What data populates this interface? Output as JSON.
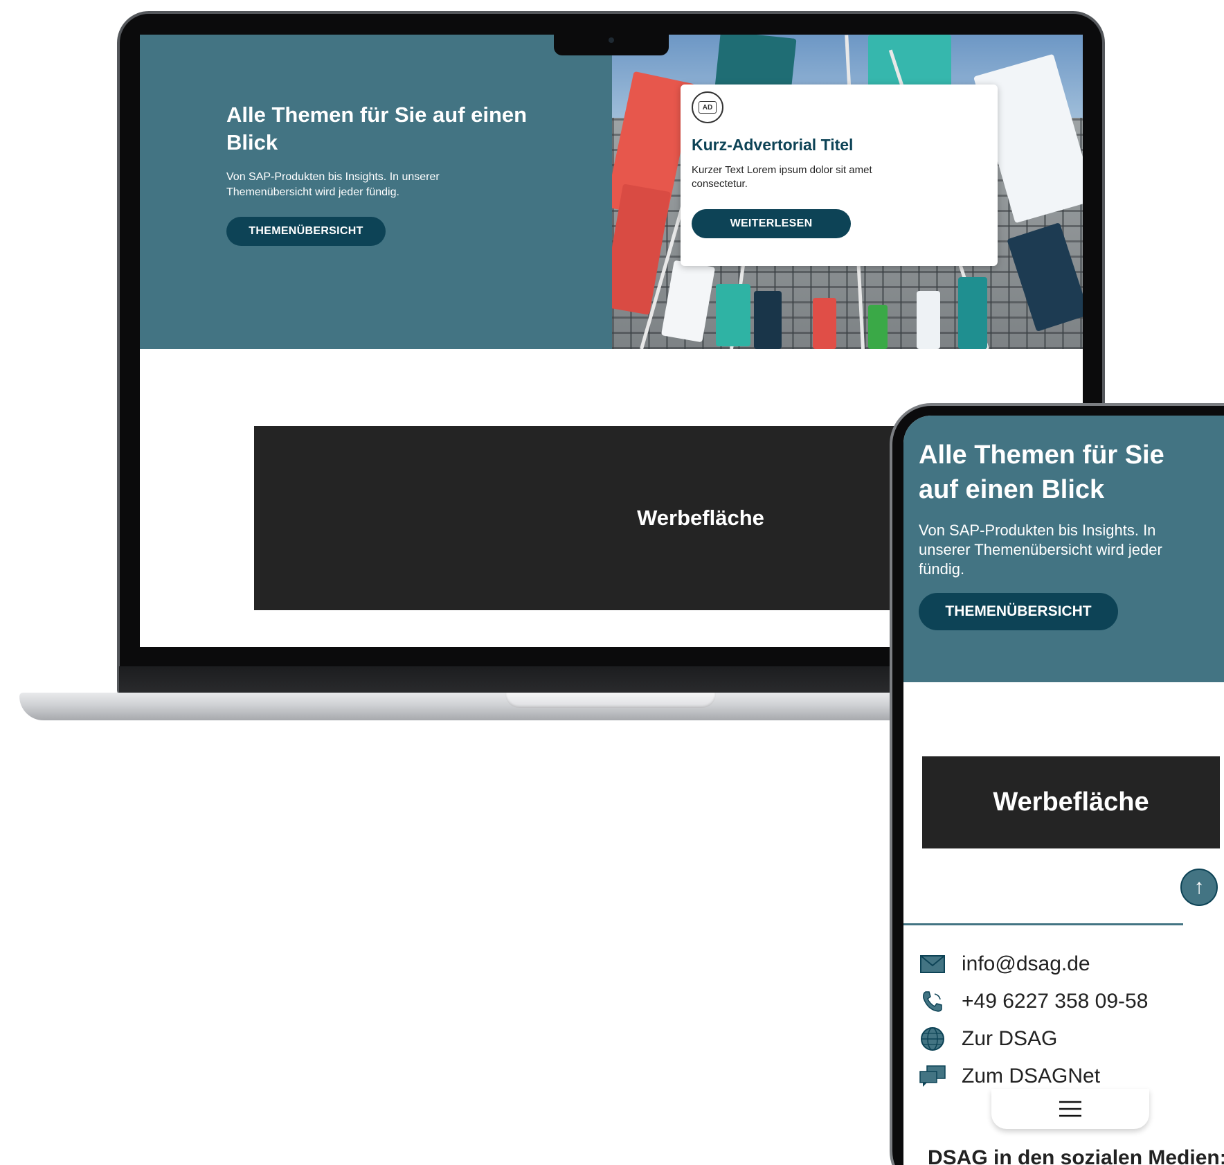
{
  "laptop": {
    "hero": {
      "title": "Alle Themen für Sie auf einen Blick",
      "text": "Von SAP-Produkten bis Insights. In unserer Themenübersicht wird jeder fündig.",
      "button_label": "THEMENÜBERSICHT"
    },
    "advertorial": {
      "badge": "AD",
      "title": "Kurz-Advertorial Titel",
      "text": "Kurzer Text Lorem ipsum dolor sit amet consectetur.",
      "button_label": "WEITERLESEN"
    },
    "ad_space_label": "Werbefläche"
  },
  "phone": {
    "hero": {
      "title": "Alle Themen für Sie auf einen Blick",
      "text": "Von SAP-Produkten bis Insights. In unserer Themenübersicht wird jeder fündig.",
      "button_label": "THEMENÜBERSICHT"
    },
    "ad_space_label": "Werbefläche",
    "scroll_top_icon": "arrow-up-icon",
    "contacts": [
      {
        "icon": "mail-icon",
        "label": "info@dsag.de"
      },
      {
        "icon": "phone-icon",
        "label": "+49 6227 358 09-58"
      },
      {
        "icon": "globe-icon",
        "label": "Zur DSAG"
      },
      {
        "icon": "chat-icon",
        "label": "Zum DSAGNet"
      }
    ],
    "menu_icon": "hamburger-menu-icon",
    "social_heading": "DSAG in den sozialen Medien:"
  },
  "colors": {
    "brand_teal": "#437483",
    "brand_dark": "#0d4356",
    "ad_space_bg": "#242424"
  }
}
